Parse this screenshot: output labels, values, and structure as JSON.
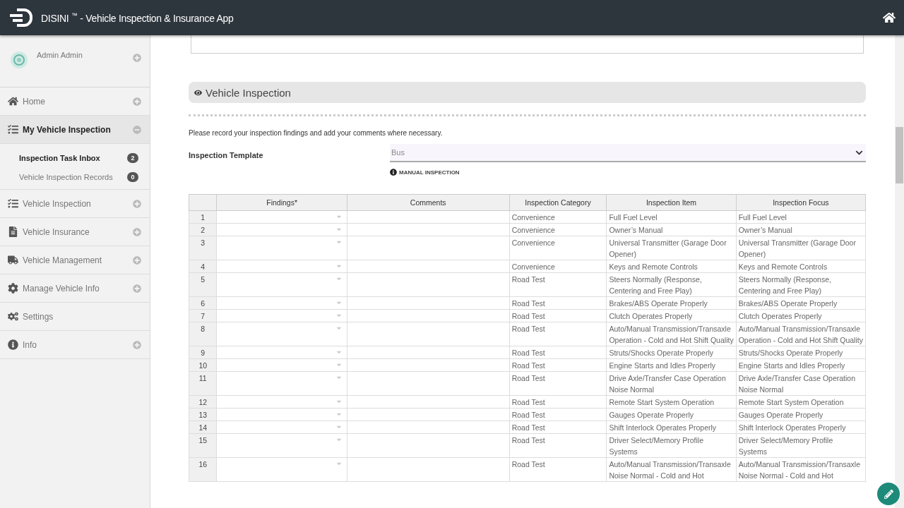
{
  "header": {
    "brand": "DISINI",
    "trademark": "™",
    "title": "- Vehicle Inspection & Insurance App"
  },
  "sidebar": {
    "user": {
      "name": "Admin Admin",
      "expanded": false
    },
    "items": [
      {
        "label": "Home",
        "expanded": false,
        "selected": false
      },
      {
        "label": "My Vehicle Inspection",
        "expanded": true,
        "selected": true,
        "children": [
          {
            "label": "Inspection Task Inbox",
            "count": "2",
            "selected": true
          },
          {
            "label": "Vehicle Inspection Records",
            "count": "0",
            "selected": false
          }
        ]
      },
      {
        "label": "Vehicle Inspection",
        "expanded": false,
        "selected": false
      },
      {
        "label": "Vehicle Insurance",
        "expanded": false,
        "selected": false
      },
      {
        "label": "Vehicle Management",
        "expanded": false,
        "selected": false
      },
      {
        "label": "Manage Vehicle Info",
        "expanded": false,
        "selected": false
      },
      {
        "label": "Settings",
        "selected": false
      },
      {
        "label": "Info",
        "expanded": false,
        "selected": false
      }
    ]
  },
  "section": {
    "title": "Vehicle Inspection",
    "instructions": "Please record your inspection findings and add your comments where necessary.",
    "template": {
      "label": "Inspection Template",
      "value": "Bus",
      "note": "MANUAL INSPECTION"
    }
  },
  "table": {
    "columns": [
      "",
      "Findings*",
      "Comments",
      "Inspection Category",
      "Inspection Item",
      "Inspection Focus"
    ],
    "rows": [
      {
        "no": "1",
        "category": "Convenience",
        "item": "Full Fuel Level",
        "focus": "Full Fuel Level"
      },
      {
        "no": "2",
        "category": "Convenience",
        "item": "Owner’s Manual",
        "focus": "Owner’s Manual"
      },
      {
        "no": "3",
        "category": "Convenience",
        "item": "Universal Transmitter (Garage Door Opener)",
        "focus": "Universal Transmitter (Garage Door Opener)"
      },
      {
        "no": "4",
        "category": "Convenience",
        "item": "Keys and Remote Controls",
        "focus": "Keys and Remote Controls"
      },
      {
        "no": "5",
        "category": "Road Test",
        "item": "Steers Normally (Response, Centering and Free Play)",
        "focus": "Steers Normally (Response, Centering and Free Play)"
      },
      {
        "no": "6",
        "category": "Road Test",
        "item": "Brakes/ABS Operate Properly",
        "focus": "Brakes/ABS Operate Properly"
      },
      {
        "no": "7",
        "category": "Road Test",
        "item": "Clutch Operates Properly",
        "focus": "Clutch Operates Properly"
      },
      {
        "no": "8",
        "category": "Road Test",
        "item": "Auto/Manual Transmission/Transaxle Operation - Cold and Hot Shift Quality",
        "focus": "Auto/Manual Transmission/Transaxle Operation - Cold and Hot Shift Quality"
      },
      {
        "no": "9",
        "category": "Road Test",
        "item": "Struts/Shocks Operate Properly",
        "focus": "Struts/Shocks Operate Properly"
      },
      {
        "no": "10",
        "category": "Road Test",
        "item": "Engine Starts and Idles Properly",
        "focus": "Engine Starts and Idles Properly"
      },
      {
        "no": "11",
        "category": "Road Test",
        "item": "Drive Axle/Transfer Case Operation Noise Normal",
        "focus": "Drive Axle/Transfer Case Operation Noise Normal"
      },
      {
        "no": "12",
        "category": "Road Test",
        "item": "Remote Start System Operation",
        "focus": "Remote Start System Operation"
      },
      {
        "no": "13",
        "category": "Road Test",
        "item": "Gauges Operate Properly",
        "focus": "Gauges Operate Properly"
      },
      {
        "no": "14",
        "category": "Road Test",
        "item": "Shift Interlock Operates Properly",
        "focus": "Shift Interlock Operates Properly"
      },
      {
        "no": "15",
        "category": "Road Test",
        "item": "Driver Select/Memory Profile Systems",
        "focus": "Driver Select/Memory Profile Systems"
      },
      {
        "no": "16",
        "category": "Road Test",
        "item": "Auto/Manual Transmission/Transaxle Noise Normal - Cold and Hot",
        "focus": "Auto/Manual Transmission/Transaxle Noise Normal - Cold and Hot"
      }
    ]
  }
}
